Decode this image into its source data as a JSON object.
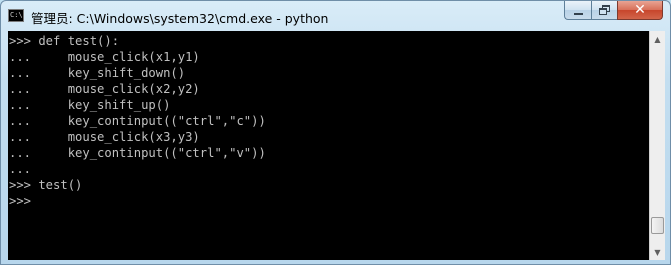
{
  "window": {
    "title": "管理员: C:\\Windows\\system32\\cmd.exe - python",
    "icon": "cmd-console-icon",
    "icon_text": "C:\\"
  },
  "caption_buttons": {
    "minimize_icon": "minimize-icon",
    "maximize_icon": "restore-icon",
    "close_icon": "close-icon",
    "close_glyph": "✕"
  },
  "console": {
    "background": "#000000",
    "foreground": "#c0c0c0",
    "lines": [
      ">>> def test():",
      "...     mouse_click(x1,y1)",
      "...     key_shift_down()",
      "...     mouse_click(x2,y2)",
      "...     key_shift_up()",
      "...     key_continput((\"ctrl\",\"c\"))",
      "...     mouse_click(x3,y3)",
      "...     key_continput((\"ctrl\",\"v\"))",
      "...",
      ">>> test()",
      ">>>"
    ]
  },
  "scrollbar": {
    "up_glyph": "▲",
    "down_glyph": "▼"
  }
}
